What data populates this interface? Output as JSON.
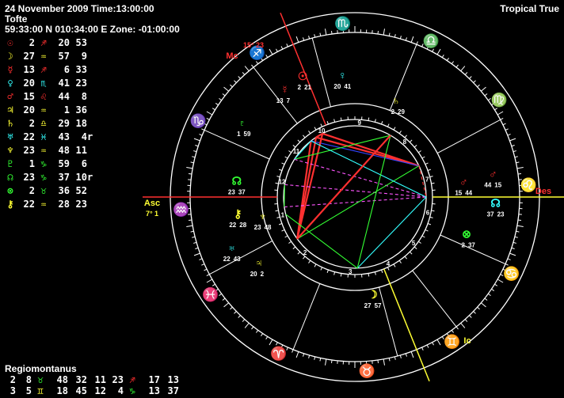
{
  "header": {
    "line1": "24 November 2009 Time:13:00:00",
    "line2": "Tofte",
    "line3": "59:33:00 N 010:34:00 E Zone: -01:00:00",
    "zodiac": "Tropical True"
  },
  "colors": {
    "red": "#ff3030",
    "yellow": "#ffff33",
    "green": "#33ff33",
    "cyan": "#33ffff",
    "magenta": "#ff55ff",
    "white": "#ffffff",
    "blue": "#3344ff"
  },
  "planets": [
    {
      "glyph": "☉",
      "color": "#ff3030",
      "deg": "2",
      "sign": "♐",
      "sign_color": "#ff3030",
      "min": "20",
      "sec": "53",
      "ret": ""
    },
    {
      "glyph": "☽",
      "color": "#ffff33",
      "deg": "27",
      "sign": "♒",
      "sign_color": "#ffff33",
      "min": "57",
      "sec": "9",
      "ret": ""
    },
    {
      "glyph": "☿",
      "color": "#ff3030",
      "deg": "13",
      "sign": "♐",
      "sign_color": "#ff3030",
      "min": "6",
      "sec": "33",
      "ret": ""
    },
    {
      "glyph": "♀",
      "color": "#33ffff",
      "deg": "20",
      "sign": "♏",
      "sign_color": "#33ffff",
      "min": "41",
      "sec": "23",
      "ret": ""
    },
    {
      "glyph": "♂",
      "color": "#ff3030",
      "deg": "15",
      "sign": "♌",
      "sign_color": "#ff3030",
      "min": "44",
      "sec": "8",
      "ret": ""
    },
    {
      "glyph": "♃",
      "color": "#ffff33",
      "deg": "20",
      "sign": "♒",
      "sign_color": "#ffff33",
      "min": "1",
      "sec": "36",
      "ret": ""
    },
    {
      "glyph": "♄",
      "color": "#ffff33",
      "deg": "2",
      "sign": "♎",
      "sign_color": "#ffff33",
      "min": "29",
      "sec": "18",
      "ret": ""
    },
    {
      "glyph": "♅",
      "color": "#33ffff",
      "deg": "22",
      "sign": "♓",
      "sign_color": "#33ffff",
      "min": "43",
      "sec": "4",
      "ret": "r"
    },
    {
      "glyph": "♆",
      "color": "#ffff33",
      "deg": "23",
      "sign": "♒",
      "sign_color": "#ffff33",
      "min": "48",
      "sec": "11",
      "ret": ""
    },
    {
      "glyph": "♇",
      "color": "#33ff33",
      "deg": "1",
      "sign": "♑",
      "sign_color": "#33ff33",
      "min": "59",
      "sec": "6",
      "ret": ""
    },
    {
      "glyph": "☊",
      "color": "#33ff33",
      "deg": "23",
      "sign": "♑",
      "sign_color": "#33ff33",
      "min": "37",
      "sec": "10",
      "ret": "r"
    },
    {
      "glyph": "⊗",
      "color": "#33ff33",
      "deg": "2",
      "sign": "♉",
      "sign_color": "#33ff33",
      "min": "36",
      "sec": "52",
      "ret": ""
    },
    {
      "glyph": "⚷",
      "color": "#ffff33",
      "deg": "22",
      "sign": "♒",
      "sign_color": "#ffff33",
      "min": "28",
      "sec": "23",
      "ret": ""
    }
  ],
  "houses": {
    "title": "Regiomontanus",
    "rows": [
      [
        {
          "num": "2",
          "deg": "8",
          "sign": "♉",
          "sign_color": "#33ff33",
          "min": "48"
        },
        {
          "num": "3",
          "deg": "2",
          "sign": "♊",
          "sign_color": "#ffff33",
          "min": "11",
          "hide_sign": true
        },
        {
          "num": "",
          "deg": "23",
          "sign": "♐",
          "sign_color": "#ff3030",
          "min": "17",
          "sec": "13"
        }
      ],
      [
        {
          "num": "3",
          "deg": "5",
          "sign": "♊",
          "sign_color": "#ffff33",
          "min": "18"
        },
        {
          "num": "",
          "deg": "45",
          "sign": "",
          "sign_color": "#ffffff",
          "min": "12"
        },
        {
          "num": "",
          "deg": "4",
          "sign": "♑",
          "sign_color": "#33ff33",
          "min": "13",
          "sec": "37"
        }
      ]
    ],
    "row1": [
      "2",
      "8",
      "♉",
      "48",
      "32",
      "11",
      "23",
      "♐",
      "17",
      "13"
    ],
    "row2": [
      "3",
      "5",
      "♊",
      "18",
      "45",
      "12",
      "4",
      "♑",
      "13",
      "37"
    ]
  },
  "wheel": {
    "angles": [
      {
        "label": "Asc",
        "deg": "7° 1",
        "color": "#ffff33"
      },
      {
        "label": "Des",
        "color": "#ff3030"
      },
      {
        "label": "Mc",
        "deg": "15° 23",
        "color": "#ff3030"
      },
      {
        "label": "Ic",
        "color": "#ffff33"
      }
    ],
    "house_numbers": [
      "1",
      "2",
      "3",
      "4",
      "5",
      "6",
      "7",
      "8",
      "9",
      "10",
      "11",
      "12"
    ],
    "zodiac": [
      {
        "glyph": "♒",
        "color": "#ffff33",
        "angle": 184
      },
      {
        "glyph": "♓",
        "color": "#33ffff",
        "angle": 214
      },
      {
        "glyph": "♈",
        "color": "#ff3030",
        "angle": 244
      },
      {
        "glyph": "♉",
        "color": "#33ff33",
        "angle": 274
      },
      {
        "glyph": "♊",
        "color": "#ffff33",
        "angle": 304
      },
      {
        "glyph": "♋",
        "color": "#33ffff",
        "angle": 334
      },
      {
        "glyph": "♌",
        "color": "#ff3030",
        "angle": 4
      },
      {
        "glyph": "♍",
        "color": "#33ff33",
        "angle": 34
      },
      {
        "glyph": "♎",
        "color": "#ffff33",
        "angle": 64
      },
      {
        "glyph": "♏",
        "color": "#33ffff",
        "angle": 94
      },
      {
        "glyph": "♐",
        "color": "#ff3030",
        "angle": 124
      },
      {
        "glyph": "♑",
        "color": "#33ff33",
        "angle": 154
      }
    ],
    "planet_labels": [
      {
        "glyph": "♀",
        "color": "#33ffff",
        "deg": "20",
        "min": "41"
      },
      {
        "glyph": "♄",
        "color": "#ffff33",
        "deg": "2",
        "min": "29"
      },
      {
        "glyph": "♂",
        "color": "#ff3030",
        "deg": "15",
        "min": "44"
      },
      {
        "glyph": "☉",
        "color": "#ff3030",
        "deg": "2",
        "min": "21"
      },
      {
        "glyph": "☿",
        "color": "#ff3030",
        "deg": "13",
        "min": "7"
      },
      {
        "glyph": "♇",
        "color": "#33ff33",
        "deg": "1",
        "min": "59"
      },
      {
        "glyph": "☊",
        "color": "#33ff33",
        "deg": "23",
        "min": "37"
      },
      {
        "glyph": "♃",
        "color": "#ffff33",
        "deg": "20",
        "min": "2"
      },
      {
        "glyph": "⚷",
        "color": "#ffff33",
        "deg": "22",
        "min": "28"
      },
      {
        "glyph": "♆",
        "color": "#ffff33",
        "deg": "23",
        "min": "48"
      },
      {
        "glyph": "☽",
        "color": "#ffff33",
        "deg": "27",
        "min": "57"
      },
      {
        "glyph": "♅",
        "color": "#33ffff",
        "deg": "22",
        "min": "43"
      },
      {
        "glyph": "⊗",
        "color": "#33ff33",
        "deg": "2",
        "min": "37"
      },
      {
        "glyph": "☊",
        "color": "#33ffff",
        "deg": "37",
        "min": "23"
      },
      {
        "glyph": "♂",
        "color": "#ff3030",
        "deg": "44",
        "min": "15"
      }
    ]
  }
}
